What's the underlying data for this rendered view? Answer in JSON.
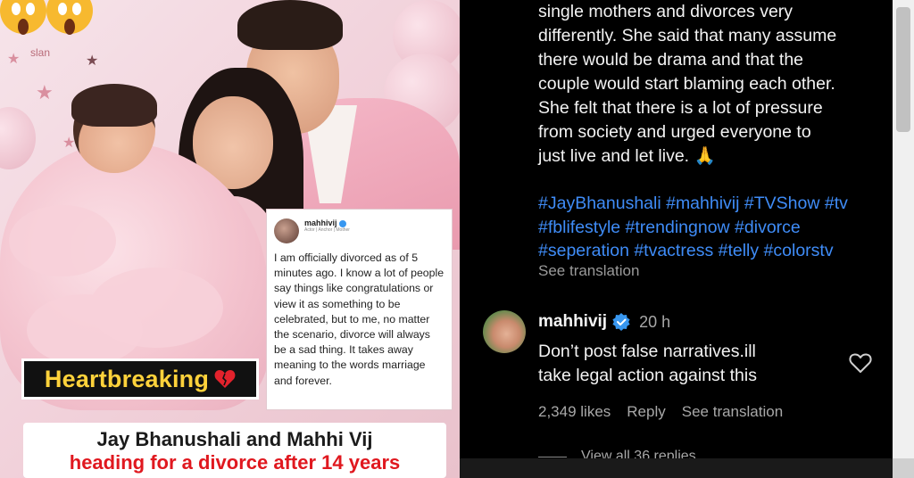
{
  "post_image": {
    "party_label": "slan",
    "quote_card": {
      "username": "mahhivij",
      "bio": "Actor | Anchor | Mother",
      "text": "I am officially divorced as of 5 minutes ago. I know a lot of people say things like congratulations or view it as something to be celebrated, but to me, no matter the scenario, divorce will always be a sad thing. It takes away meaning to the words marriage and forever."
    },
    "tag_label": "Heartbreaking",
    "headline_line1": "Jay Bhanushali and Mahhi Vij",
    "headline_line2": "heading for a divorce after 14 years",
    "colors": {
      "tag_text": "#ffd23b",
      "headline_red": "#e0181f"
    }
  },
  "caption": {
    "lines": [
      "single mothers and divorces very",
      "differently. She said that many assume",
      "there would be drama and that the",
      "couple would start blaming each other.",
      "She felt that there is a lot of pressure",
      "from society and urged everyone to",
      "just live and let live. 🙏"
    ],
    "hashtag_lines": [
      "#JayBhanushali #mahhivij #TVShow #tv",
      "#fblifestyle #trendingnow #divorce",
      "#seperation #tvactress #telly #colorstv"
    ],
    "see_translation": "See translation"
  },
  "comment": {
    "username": "mahhivij",
    "time": "20 h",
    "text_lines": [
      "Don’t post false narratives.ill",
      "take legal action against this"
    ],
    "likes": "2,349 likes",
    "reply": "Reply",
    "see_translation": "See translation",
    "view_replies": "View all 36 replies",
    "colors": {
      "hashtag": "#3f8cf7",
      "verified": "#3897f0"
    }
  }
}
